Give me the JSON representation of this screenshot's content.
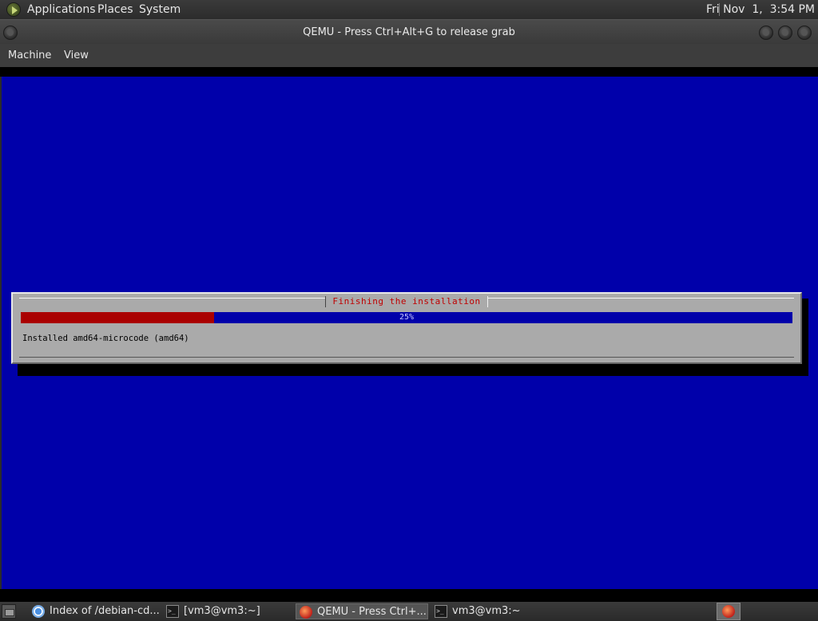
{
  "top_panel": {
    "menus": [
      "Applications",
      "Places",
      "System"
    ],
    "clock": "Fri Nov  1,  3:54 PM"
  },
  "window": {
    "title": "QEMU - Press Ctrl+Alt+G to release grab",
    "menu": [
      "Machine",
      "View"
    ]
  },
  "installer": {
    "dialog_title": "Finishing the installation",
    "progress_percent": 25,
    "progress_label": "25%",
    "status": "Installed amd64-microcode (amd64)",
    "colors": {
      "background": "#0000aa",
      "bar_fill": "#aa0000",
      "dialog": "#aaaaaa",
      "title": "#c00000"
    }
  },
  "taskbar": {
    "tasks": [
      {
        "label": "Index of /debian-cd...",
        "icon": "chrome-icon"
      },
      {
        "label": "[vm3@vm3:~]",
        "icon": "terminal-icon"
      },
      {
        "label": "QEMU - Press Ctrl+...",
        "icon": "qemu-icon",
        "active": true
      },
      {
        "label": "vm3@vm3:~",
        "icon": "terminal-icon"
      }
    ]
  }
}
